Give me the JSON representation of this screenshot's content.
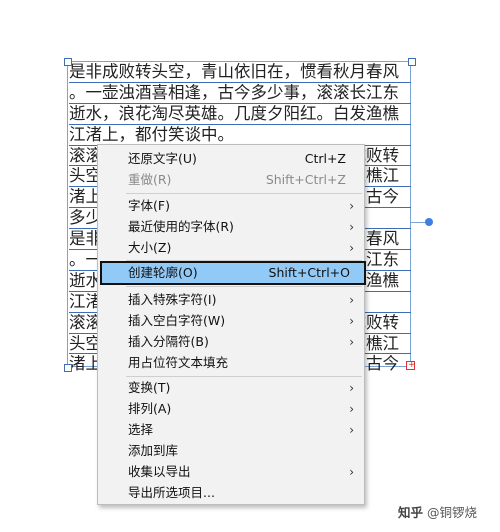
{
  "document_text": {
    "lines": [
      "是非成败转头空，青山依旧在，惯看秋月春风",
      "。一壶浊酒喜相逢，古今多少事，滚滚长江东",
      "逝水，浪花淘尽英雄。几度夕阳红。白发渔樵",
      "江渚上，都付笑谈中。",
      "滚滚长江东逝水，浪花淘尽英雄。是非成败转",
      "头空，青山依旧在，几度夕阳红。白发渔樵江",
      "渚上，惯看秋月春风。一壶浊酒喜相逢，古今",
      "多少事，都付笑谈中。",
      "是非成败转头空，青山依旧在，惯看秋月春风",
      "。一壶浊酒喜相逢，古今多少事，滚滚长江东",
      "逝水，浪花淘尽英雄。几度夕阳红。白发渔樵",
      "江渚上，都付笑谈中。",
      "滚滚长江东逝水，浪花淘尽英雄。是非成败转",
      "头空，青山依旧在，几度夕阳红。白发渔樵江",
      "渚上，惯看秋月春风。一壶浊酒喜相逢，古今"
    ]
  },
  "overflow_marker": "+",
  "menu": {
    "undo": {
      "label": "还原文字(U)",
      "shortcut": "Ctrl+Z"
    },
    "redo": {
      "label": "重做(R)",
      "shortcut": "Shift+Ctrl+Z"
    },
    "font": {
      "label": "字体(F)"
    },
    "recent_fonts": {
      "label": "最近使用的字体(R)"
    },
    "size": {
      "label": "大小(Z)"
    },
    "create_outlines": {
      "label": "创建轮廓(O)",
      "shortcut": "Shift+Ctrl+O"
    },
    "insert_special": {
      "label": "插入特殊字符(I)"
    },
    "insert_whitespace": {
      "label": "插入空白字符(W)"
    },
    "insert_break": {
      "label": "插入分隔符(B)"
    },
    "fill_placeholder": {
      "label": "用占位符文本填充"
    },
    "transform": {
      "label": "变换(T)"
    },
    "arrange": {
      "label": "排列(A)"
    },
    "select": {
      "label": "选择"
    },
    "add_to_library": {
      "label": "添加到库"
    },
    "collect_export": {
      "label": "收集以导出"
    },
    "export_selection": {
      "label": "导出所选项目..."
    },
    "submenu_arrow": "›"
  },
  "watermark": {
    "brand": "知乎",
    "author": "@铜锣烧"
  },
  "colors": {
    "highlight": "#91c9f7",
    "frame": "#7aa4d6",
    "handle": "#3f7fe0"
  }
}
